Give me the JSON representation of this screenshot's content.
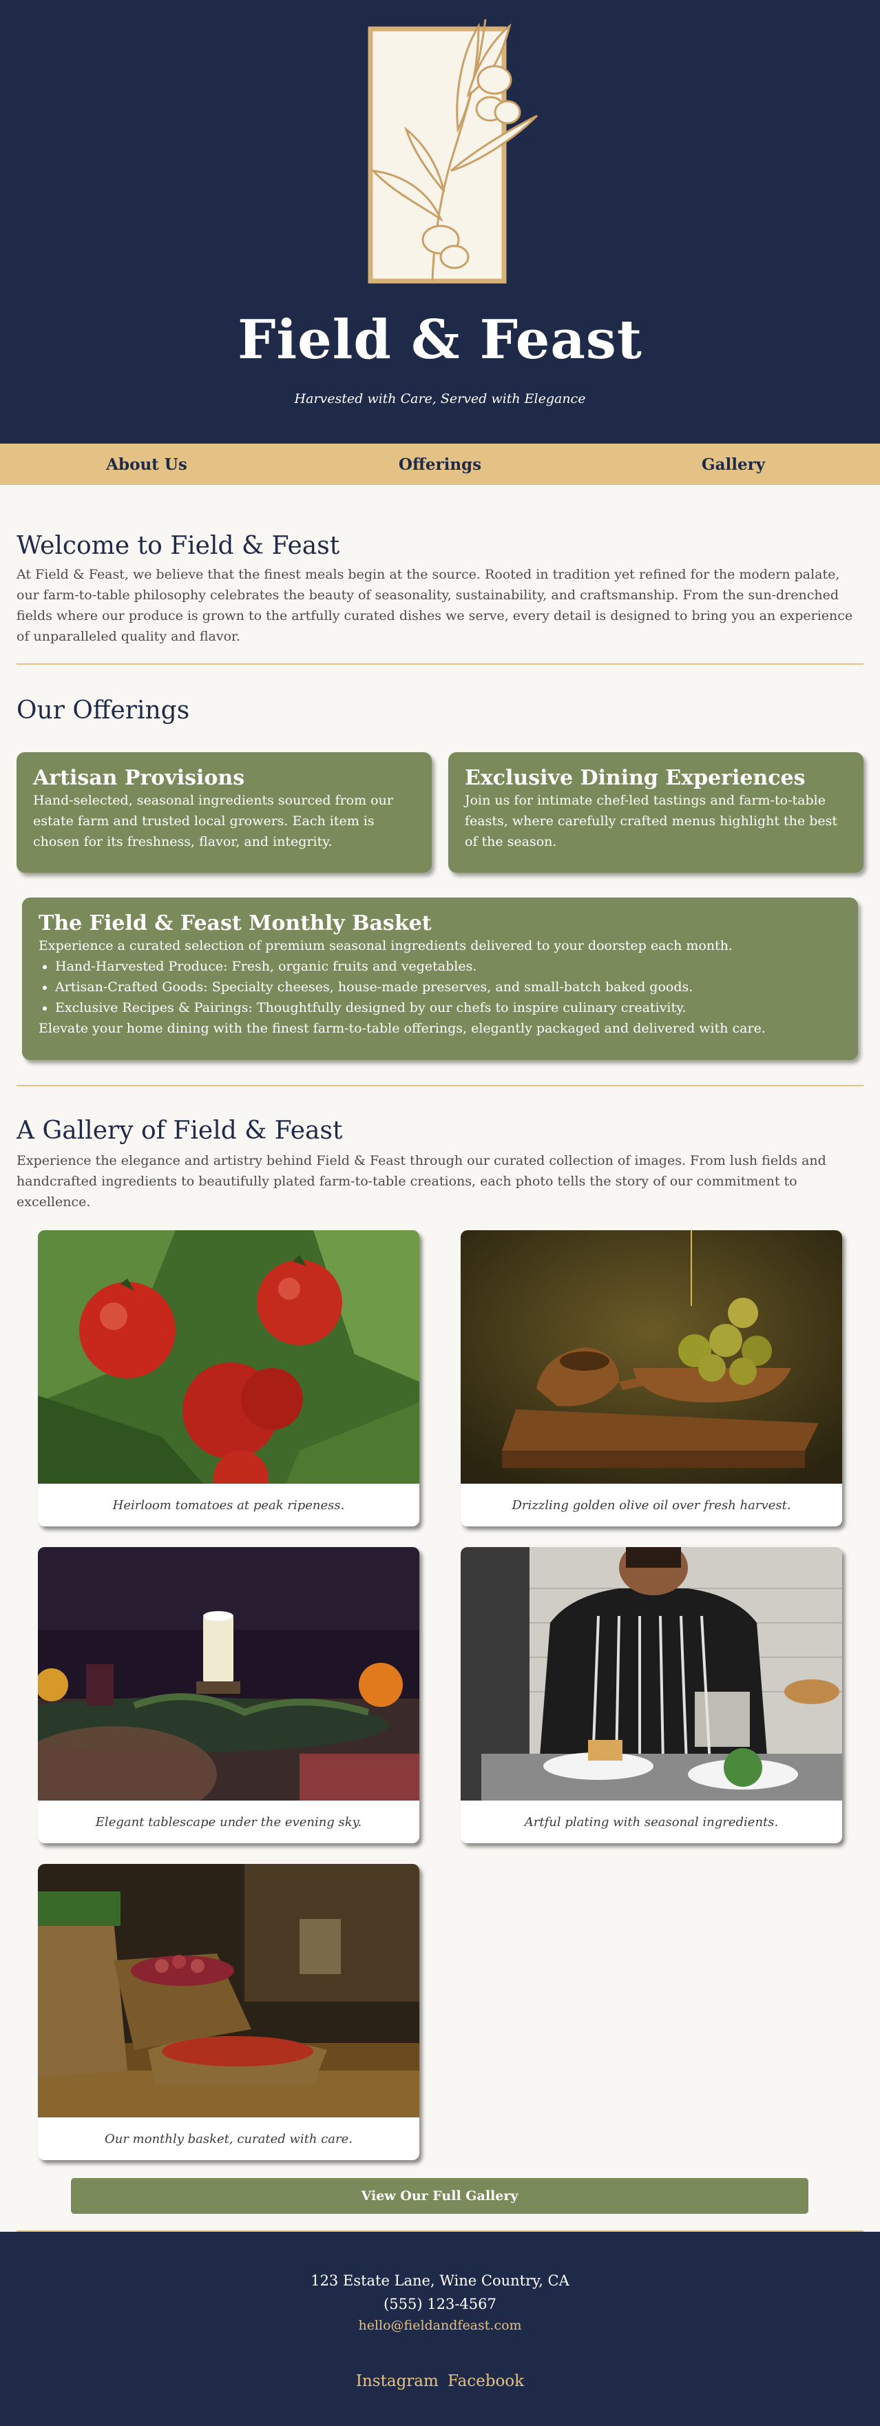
{
  "brand": {
    "title": "Field & Feast",
    "tagline": "Harvested with Care, Served with Elegance",
    "colors": {
      "navy": "#1f2a48",
      "gold": "#e4c285",
      "olive": "#7a8a5a",
      "cream": "#f8f7f3"
    }
  },
  "nav": {
    "items": [
      "About Us",
      "Offerings",
      "Gallery"
    ]
  },
  "welcome": {
    "title": "Welcome to Field & Feast",
    "body": "At Field & Feast, we believe that the finest meals begin at the source. Rooted in tradition yet refined for the modern palate, our farm-to-table philosophy celebrates the beauty of seasonality, sustainability, and craftsmanship. From the sun-drenched fields where our produce is grown to the artfully curated dishes we serve, every detail is designed to bring you an experience of unparalleled quality and flavor."
  },
  "offerings": {
    "title": "Our Offerings",
    "cards": [
      {
        "title": "Artisan Provisions",
        "body": "Hand-selected, seasonal ingredients sourced from our estate farm and trusted local growers. Each item is chosen for its freshness, flavor, and integrity."
      },
      {
        "title": "Exclusive Dining Experiences",
        "body": "Join us for intimate chef-led tastings and farm-to-table feasts, where carefully crafted menus highlight the best of the season."
      }
    ],
    "basket": {
      "title": "The Field & Feast Monthly Basket",
      "intro": "Experience a curated selection of premium seasonal ingredients delivered to your doorstep each month.",
      "items": [
        "Hand-Harvested Produce: Fresh, organic fruits and vegetables.",
        "Artisan-Crafted Goods: Specialty cheeses, house-made preserves, and small-batch baked goods.",
        "Exclusive Recipes & Pairings: Thoughtfully designed by our chefs to inspire culinary creativity."
      ],
      "outro": "Elevate your home dining with the finest farm-to-table offerings, elegantly packaged and delivered with care."
    }
  },
  "gallery": {
    "title": "A Gallery of Field & Feast",
    "intro": "Experience the elegance and artistry behind Field & Feast through our curated collection of images. From lush fields and handcrafted ingredients to beautifully plated farm-to-table creations, each photo tells the story of our commitment to excellence.",
    "photos": [
      {
        "icon": "tomatoes-photo",
        "caption": "Heirloom tomatoes at peak ripeness."
      },
      {
        "icon": "olive-oil-photo",
        "caption": "Drizzling golden olive oil over fresh harvest."
      },
      {
        "icon": "tablescape-photo",
        "caption": "Elegant tablescape under the evening sky."
      },
      {
        "icon": "chef-plating-photo",
        "caption": "Artful plating with seasonal ingredients."
      },
      {
        "icon": "basket-photo",
        "caption": "Our monthly basket, curated with care."
      }
    ],
    "button": "View Our Full Gallery"
  },
  "footer": {
    "address": "123 Estate Lane, Wine Country, CA",
    "phone": "(555) 123-4567",
    "email": "hello@fieldandfeast.com",
    "social": [
      "Instagram",
      "Facebook"
    ]
  }
}
